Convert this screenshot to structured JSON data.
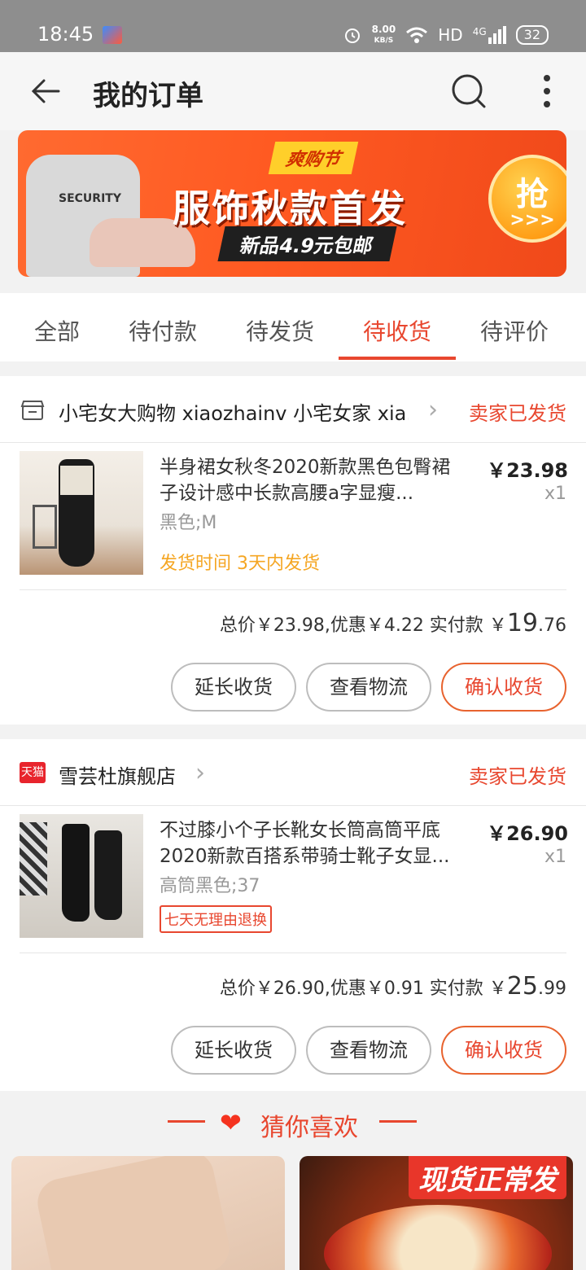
{
  "status_bar": {
    "time": "18:45",
    "net_speed_value": "8.00",
    "net_speed_unit": "KB/S",
    "hd": "HD",
    "signal": "4G",
    "battery": "32"
  },
  "header": {
    "title": "我的订单"
  },
  "banner": {
    "tag": "爽购节",
    "headline": "服饰秋款首发",
    "sub": "新品4.9元包邮",
    "grab_label": "抢",
    "grab_arrows": ">>>",
    "sweater_text": "SECURITY"
  },
  "tabs": [
    {
      "label": "全部"
    },
    {
      "label": "待付款"
    },
    {
      "label": "待发货"
    },
    {
      "label": "待收货"
    },
    {
      "label": "待评价"
    }
  ],
  "orders": [
    {
      "shop_name": "小宅女大购物 xiaozhainv 小宅女家 xia...",
      "status": "卖家已发货",
      "item_title": "半身裙女秋冬2020新款黑色包臀裙子设计感中长款高腰a字显瘦...",
      "sku": "黑色;M",
      "price": "￥23.98",
      "qty": "x1",
      "note": "发货时间 3天内发货",
      "totals_prefix": "总价￥23.98,优惠￥4.22   实付款 ￥",
      "paid_int": "19",
      "paid_dec": ".76",
      "buttons": [
        "延长收货",
        "查看物流",
        "确认收货"
      ]
    },
    {
      "shop_name": "雪芸杜旗舰店",
      "shop_badge": "天猫",
      "status": "卖家已发货",
      "item_title": "不过膝小个子长靴女长筒高筒平底2020新款百搭系带骑士靴子女显...",
      "sku": "高筒黑色;37",
      "price": "￥26.90",
      "qty": "x1",
      "badge": "七天无理由退换",
      "totals_prefix": "总价￥26.90,优惠￥0.91   实付款 ￥",
      "paid_int": "25",
      "paid_dec": ".99",
      "buttons": [
        "延长收货",
        "查看物流",
        "确认收货"
      ]
    }
  ],
  "recommend": {
    "title": "猜你喜欢",
    "right_tag": "现货正常发"
  },
  "colors": {
    "accent": "#e8472f",
    "note": "#f5a623",
    "tmall": "#e8242c"
  }
}
